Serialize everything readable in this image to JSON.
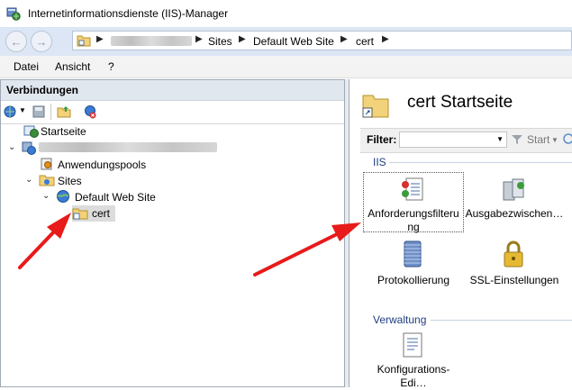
{
  "window": {
    "title": "Internetinformationsdienste (IIS)-Manager"
  },
  "addressbar": {
    "crumbs": [
      "Sites",
      "Default Web Site",
      "cert"
    ]
  },
  "menu": [
    "Datei",
    "Ansicht",
    "?"
  ],
  "connections": {
    "header": "Verbindungen",
    "tree": {
      "start": "Startseite",
      "pools": "Anwendungspools",
      "sites": "Sites",
      "site": "Default Web Site",
      "cert": "cert"
    }
  },
  "page": {
    "title": "cert Startseite",
    "filter_label": "Filter:",
    "filter_value": "",
    "start_label": "Start",
    "groups": {
      "iis": "IIS",
      "verwaltung": "Verwaltung"
    },
    "features": {
      "request_filtering": "Anforderungsfilteru ng",
      "output_cache": "Ausgabezwischen…",
      "logging": "Protokollierung",
      "ssl": "SSL-Einstellungen",
      "config_editor": "Konfigurations-Edi…"
    }
  },
  "colors": {
    "arrow": "#e81a1a",
    "group_label": "#1e3e80"
  }
}
